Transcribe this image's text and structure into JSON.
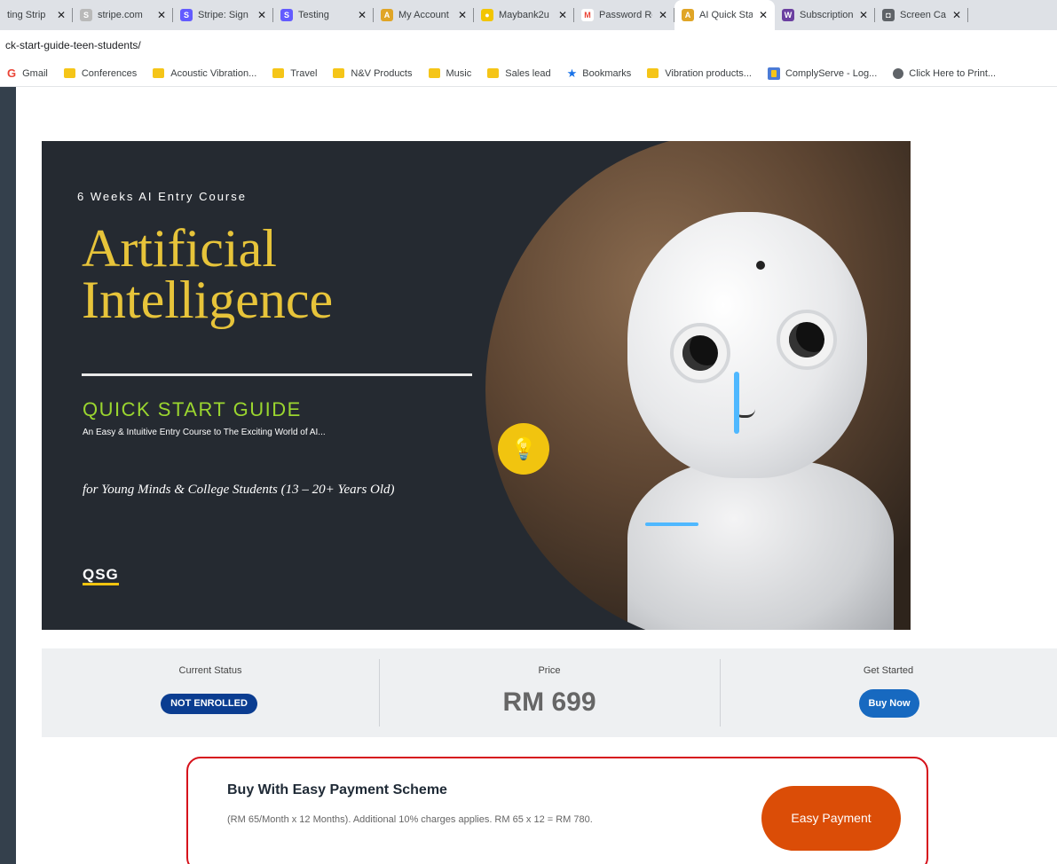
{
  "browser": {
    "tabs": [
      {
        "title": "ting Strip",
        "favicon": "s-icon",
        "fav_color": "#8e8e8e",
        "active": false
      },
      {
        "title": "stripe.com",
        "favicon": "s-icon",
        "fav_color": "#b9b9b9",
        "active": false
      },
      {
        "title": "Stripe: Sign",
        "favicon": "s-icon",
        "fav_color": "#635bff",
        "active": false
      },
      {
        "title": "Testing",
        "favicon": "s-icon",
        "fav_color": "#635bff",
        "active": false
      },
      {
        "title": "My Account",
        "favicon": "ai-icon",
        "fav_color": "#e0a526",
        "active": false
      },
      {
        "title": "Maybank2u",
        "favicon": "maybank-icon",
        "fav_color": "#f2c500",
        "active": false
      },
      {
        "title": "Password Re",
        "favicon": "gmail-icon",
        "fav_color": "#ffffff",
        "active": false
      },
      {
        "title": "AI Quick Sta",
        "favicon": "ai-icon",
        "fav_color": "#e0a526",
        "active": true
      },
      {
        "title": "Subscription",
        "favicon": "w-icon",
        "fav_color": "#6b3fa0",
        "active": false
      },
      {
        "title": "Screen Capt",
        "favicon": "camera-icon",
        "fav_color": "#5f6368",
        "active": false
      }
    ],
    "close_glyph": "✕",
    "url": "ck-start-guide-teen-students/",
    "bookmarks": [
      {
        "label": "Gmail",
        "icon": "google-icon"
      },
      {
        "label": "Conferences",
        "icon": "folder-icon"
      },
      {
        "label": "Acoustic Vibration...",
        "icon": "folder-icon"
      },
      {
        "label": "Travel",
        "icon": "folder-icon"
      },
      {
        "label": "N&V Products",
        "icon": "folder-icon"
      },
      {
        "label": "Music",
        "icon": "folder-icon"
      },
      {
        "label": "Sales lead",
        "icon": "folder-icon"
      },
      {
        "label": "Bookmarks",
        "icon": "star-icon"
      },
      {
        "label": "Vibration products...",
        "icon": "folder-icon"
      },
      {
        "label": "ComplyServe - Log...",
        "icon": "complyserve-icon"
      },
      {
        "label": "Click Here to Print...",
        "icon": "globe-icon"
      }
    ]
  },
  "hero": {
    "kicker": "6 Weeks AI Entry Course",
    "title_line1": "Artificial",
    "title_line2": "Intelligence",
    "subtitle": "QUICK START GUIDE",
    "description": "An Easy & Intuitive Entry Course to The Exciting World of AI...",
    "audience": "for Young Minds & College Students (13 – 20+ Years Old)",
    "logo": "QSG",
    "colors": {
      "title": "#e7c43a",
      "subtitle": "#9bd62f",
      "background": "#252a31"
    }
  },
  "status": {
    "current_status_label": "Current Status",
    "current_status_value": "NOT ENROLLED",
    "price_label": "Price",
    "price_value": "RM 699",
    "get_started_label": "Get Started",
    "buy_button": "Buy Now"
  },
  "payment": {
    "title": "Buy With Easy Payment Scheme",
    "description": "(RM 65/Month x 12 Months). Additional 10% charges applies. RM 65 x 12 = RM 780.",
    "button": "Easy Payment",
    "accent": "#db4d07",
    "border_color": "#d6121b"
  }
}
